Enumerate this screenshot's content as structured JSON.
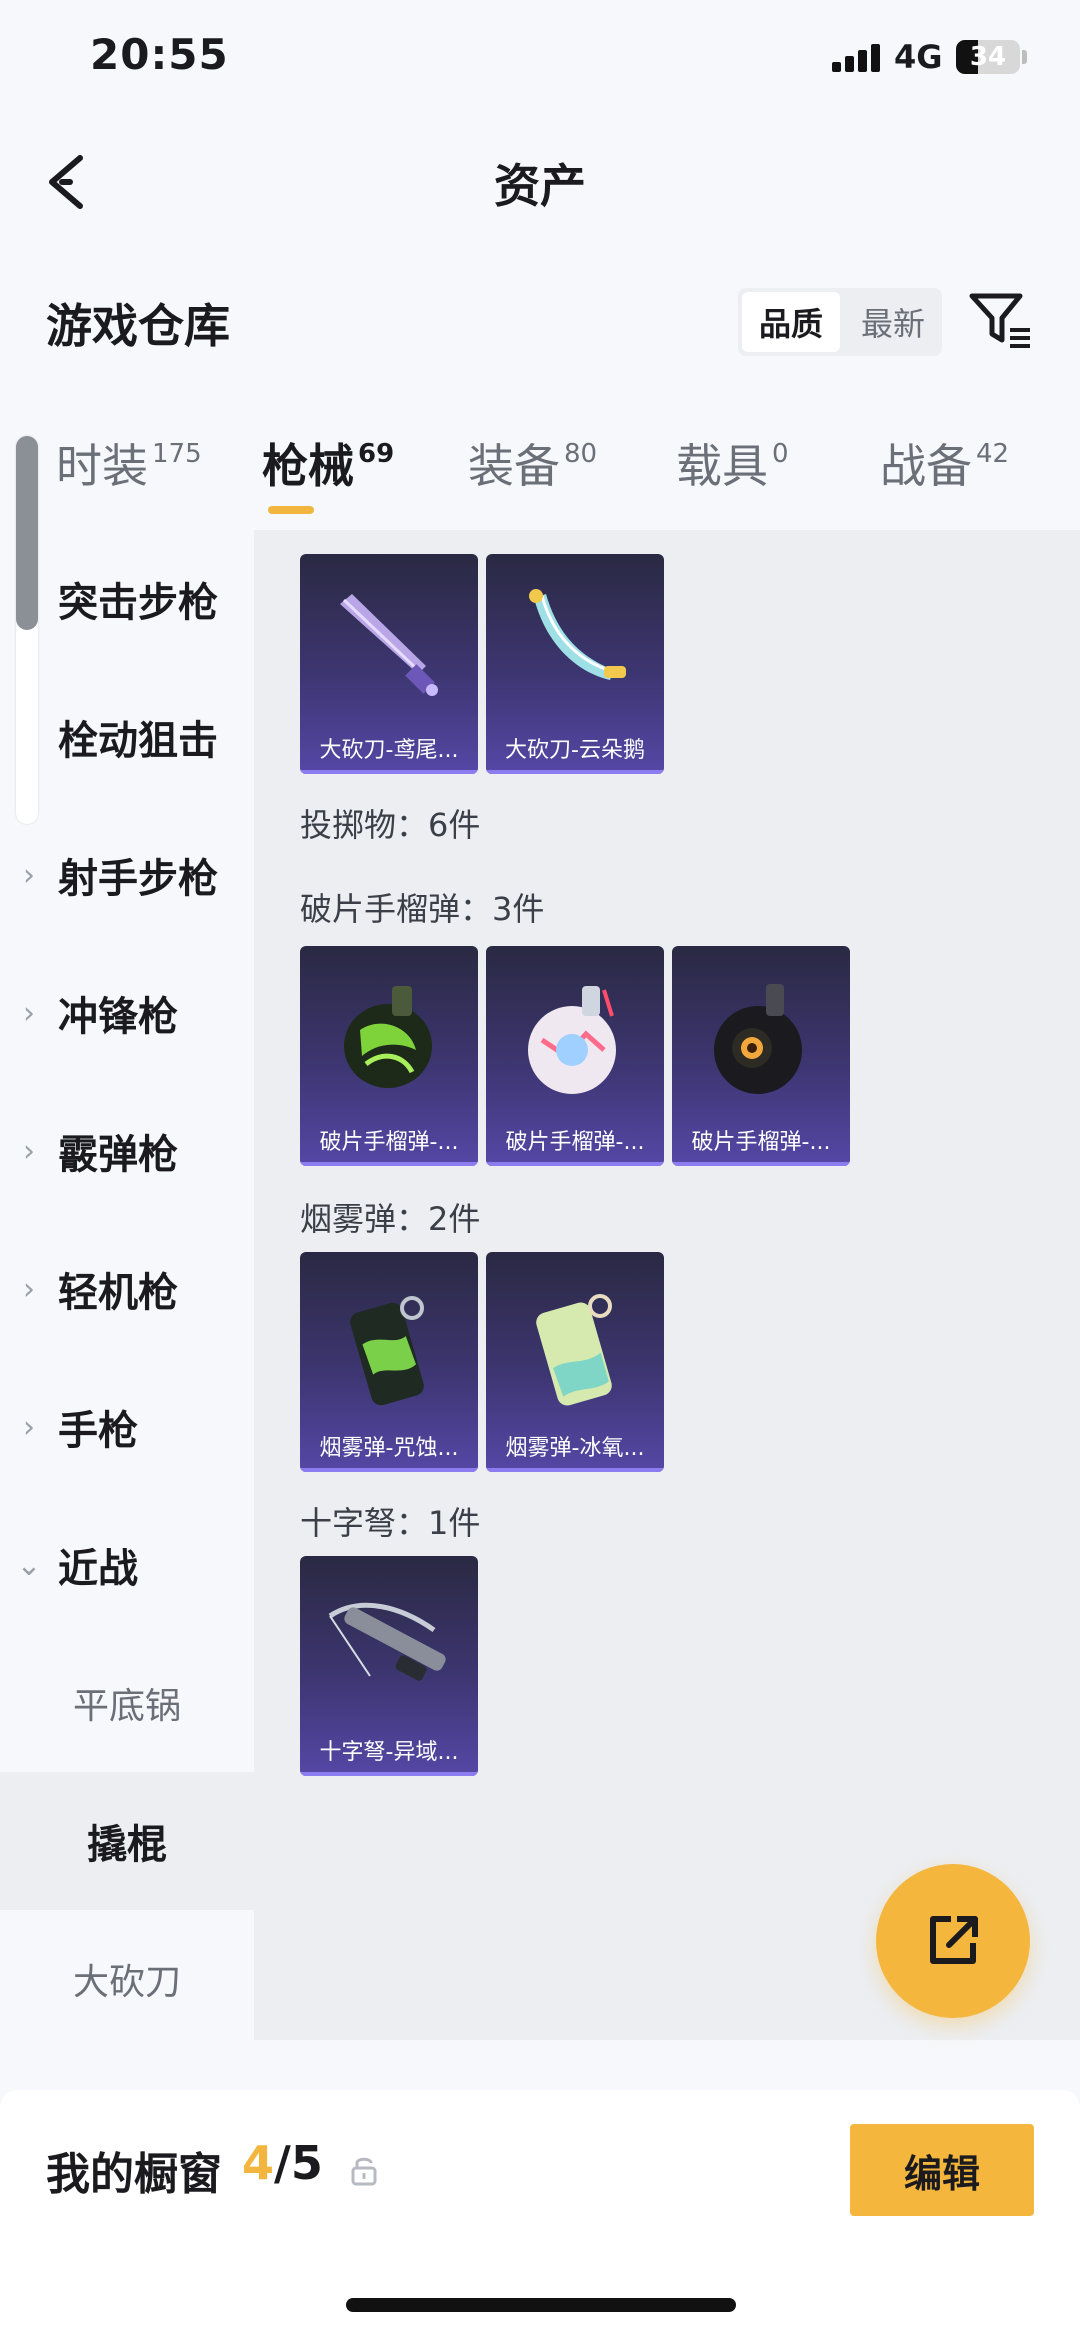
{
  "status_bar": {
    "time": "20:55",
    "network": "4G",
    "battery": "34",
    "battery_level": 0.34
  },
  "header": {
    "title": "资产",
    "back_icon": "chevron-left-icon"
  },
  "section": {
    "title": "游戏仓库",
    "sort_options": [
      "品质",
      "最新"
    ],
    "sort_active": "品质",
    "filter_icon": "filter-list-icon"
  },
  "tabs": [
    {
      "label": "时装",
      "count": "175",
      "active": false
    },
    {
      "label": "枪械",
      "count": "69",
      "active": true
    },
    {
      "label": "装备",
      "count": "80",
      "active": false
    },
    {
      "label": "载具",
      "count": "0",
      "active": false
    },
    {
      "label": "战备",
      "count": "42",
      "active": false
    }
  ],
  "sidebar": {
    "categories": [
      {
        "label": "突击步枪",
        "expanded": false
      },
      {
        "label": "栓动狙击",
        "expanded": false
      },
      {
        "label": "射手步枪",
        "expanded": false
      },
      {
        "label": "冲锋枪",
        "expanded": false
      },
      {
        "label": "霰弹枪",
        "expanded": false
      },
      {
        "label": "轻机枪",
        "expanded": false
      },
      {
        "label": "手枪",
        "expanded": false
      },
      {
        "label": "近战",
        "expanded": true
      }
    ],
    "subcategories": [
      {
        "label": "平底锅",
        "active": false
      },
      {
        "label": "撬棍",
        "active": true
      },
      {
        "label": "大砍刀",
        "active": false
      }
    ]
  },
  "content": {
    "top_cards": [
      {
        "label": "大砍刀-鸢尾...",
        "item": "purple-machete"
      },
      {
        "label": "大砍刀-云朵鹅",
        "item": "cloud-goose-machete"
      }
    ],
    "groups": [
      {
        "label": "投掷物：6件"
      },
      {
        "label": "破片手榴弹：3件"
      },
      {
        "label": "烟雾弹：2件"
      },
      {
        "label": "十字弩：1件"
      }
    ],
    "grenade_cards": [
      {
        "label": "破片手榴弹-...",
        "item": "green-grenade"
      },
      {
        "label": "破片手榴弹-...",
        "item": "white-grenade"
      },
      {
        "label": "破片手榴弹-...",
        "item": "black-grenade"
      }
    ],
    "smoke_cards": [
      {
        "label": "烟雾弹-咒蚀...",
        "item": "green-smoke"
      },
      {
        "label": "烟雾弹-冰氧...",
        "item": "ice-smoke"
      }
    ],
    "crossbow_cards": [
      {
        "label": "十字弩-异域...",
        "item": "crossbow"
      }
    ]
  },
  "fab": {
    "icon": "share-icon"
  },
  "showcase": {
    "title": "我的橱窗",
    "current": "4",
    "total": "/5",
    "edit_label": "编辑",
    "lock_icon": "lock-icon"
  },
  "colors": {
    "accent": "#f5b63d",
    "card_top": "#2a2942",
    "card_bottom": "#5547a6"
  }
}
